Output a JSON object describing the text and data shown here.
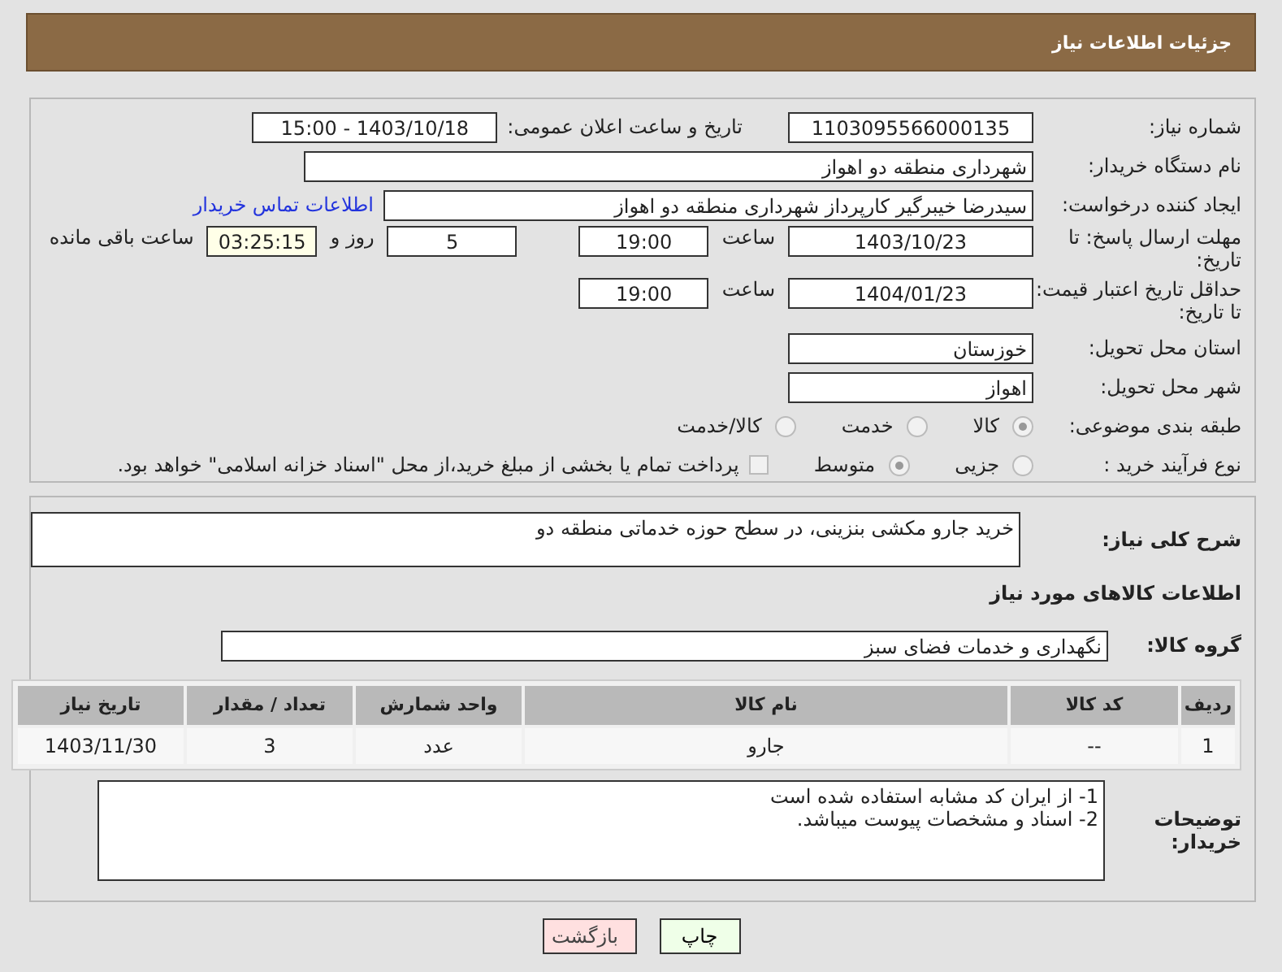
{
  "header": {
    "title": "جزئیات اطلاعات نیاز"
  },
  "need_number": {
    "label": "شماره نیاز:",
    "value": "1103095566000135"
  },
  "announce": {
    "label": "تاریخ و ساعت اعلان عمومی:",
    "value": "1403/10/18 - 15:00"
  },
  "buyer_org": {
    "label": "نام دستگاه خریدار:",
    "value": "شهرداری منطقه دو اهواز"
  },
  "requester": {
    "label": "ایجاد کننده درخواست:",
    "value": "سیدرضا خیبرگیر کارپرداز  شهرداری منطقه دو اهواز",
    "link": "اطلاعات تماس خریدار"
  },
  "reply_deadline": {
    "label": "مهلت ارسال پاسخ: تا تاریخ:",
    "date": "1403/10/23",
    "time_label": "ساعت",
    "time": "19:00",
    "days": "5",
    "days_label": "روز و",
    "remaining": "03:25:15",
    "remaining_label": "ساعت باقی مانده"
  },
  "price_validity": {
    "label": "حداقل تاریخ اعتبار قیمت: تا تاریخ:",
    "date": "1404/01/23",
    "time_label": "ساعت",
    "time": "19:00"
  },
  "province": {
    "label": "استان محل تحویل:",
    "value": "خوزستان"
  },
  "city": {
    "label": "شهر محل تحویل:",
    "value": "اهواز"
  },
  "category": {
    "label": "طبقه بندی موضوعی:",
    "options": [
      {
        "label": "کالا",
        "selected": true
      },
      {
        "label": "خدمت",
        "selected": false
      },
      {
        "label": "کالا/خدمت",
        "selected": false
      }
    ]
  },
  "purchase_type": {
    "label": "نوع فرآیند خرید :",
    "options": [
      {
        "label": "جزیی",
        "selected": false
      },
      {
        "label": "متوسط",
        "selected": true
      }
    ],
    "payment_note": {
      "checked": false,
      "text": "پرداخت تمام یا بخشی از مبلغ خرید،از محل \"اسناد خزانه اسلامی\" خواهد بود."
    }
  },
  "description": {
    "label": "شرح کلی نیاز:",
    "value": "خرید جارو مکشی بنزینی، در سطح حوزه خدماتی منطقه دو"
  },
  "goods_title": "اطلاعات کالاهای مورد نیاز",
  "goods_group": {
    "label": "گروه کالا:",
    "value": "نگهداری و خدمات فضای سبز"
  },
  "table": {
    "columns": [
      "ردیف",
      "کد کالا",
      "نام کالا",
      "واحد شمارش",
      "تعداد / مقدار",
      "تاریخ نیاز"
    ],
    "rows": [
      [
        "1",
        "--",
        "جارو",
        "عدد",
        "3",
        "1403/11/30"
      ]
    ]
  },
  "buyer_notes": {
    "label": "توضیحات خریدار:",
    "lines": [
      "1- از ایران کد مشابه استفاده شده است",
      "2- اسناد و مشخصات پیوست میباشد."
    ]
  },
  "buttons": [
    {
      "label": "چاپ",
      "kind": "print"
    },
    {
      "label": "بازگشت",
      "kind": "back"
    }
  ]
}
